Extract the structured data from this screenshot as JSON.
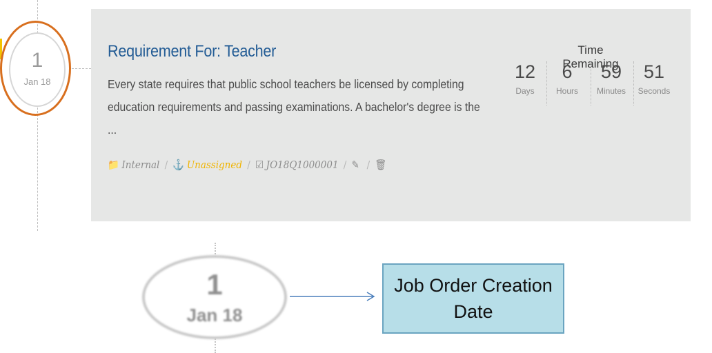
{
  "timeline": {
    "day": "1",
    "month": "Jan 18"
  },
  "card": {
    "title": "Requirement For: Teacher",
    "description": "Every state requires that public school teachers be licensed by completing education requirements and passing examinations. A bachelor's degree is the ...",
    "meta": {
      "category": "Internal",
      "status": "Unassigned",
      "job_order_id": "JO18Q1000001",
      "category_icon": "folder-icon",
      "status_icon": "anchor-icon",
      "id_icon": "checkbox-icon",
      "edit_icon": "pencil-icon",
      "delete_icon": "trash-icon"
    },
    "time_remaining": {
      "label": "Time Remaining",
      "days": {
        "value": "12",
        "unit": "Days"
      },
      "hours": {
        "value": "6",
        "unit": "Hours"
      },
      "minutes": {
        "value": "59",
        "unit": "Minutes"
      },
      "seconds": {
        "value": "51",
        "unit": "Seconds"
      }
    }
  },
  "zoom": {
    "day": "1",
    "month": "Jan 18"
  },
  "callout": {
    "text": "Job Order Creation Date"
  },
  "colors": {
    "highlight_ring": "#d86f1e",
    "title": "#235c95",
    "unassigned": "#f0b400",
    "callout_bg": "#b7dee8",
    "callout_border": "#6aa4c0",
    "card_bg": "#e6e7e6"
  }
}
